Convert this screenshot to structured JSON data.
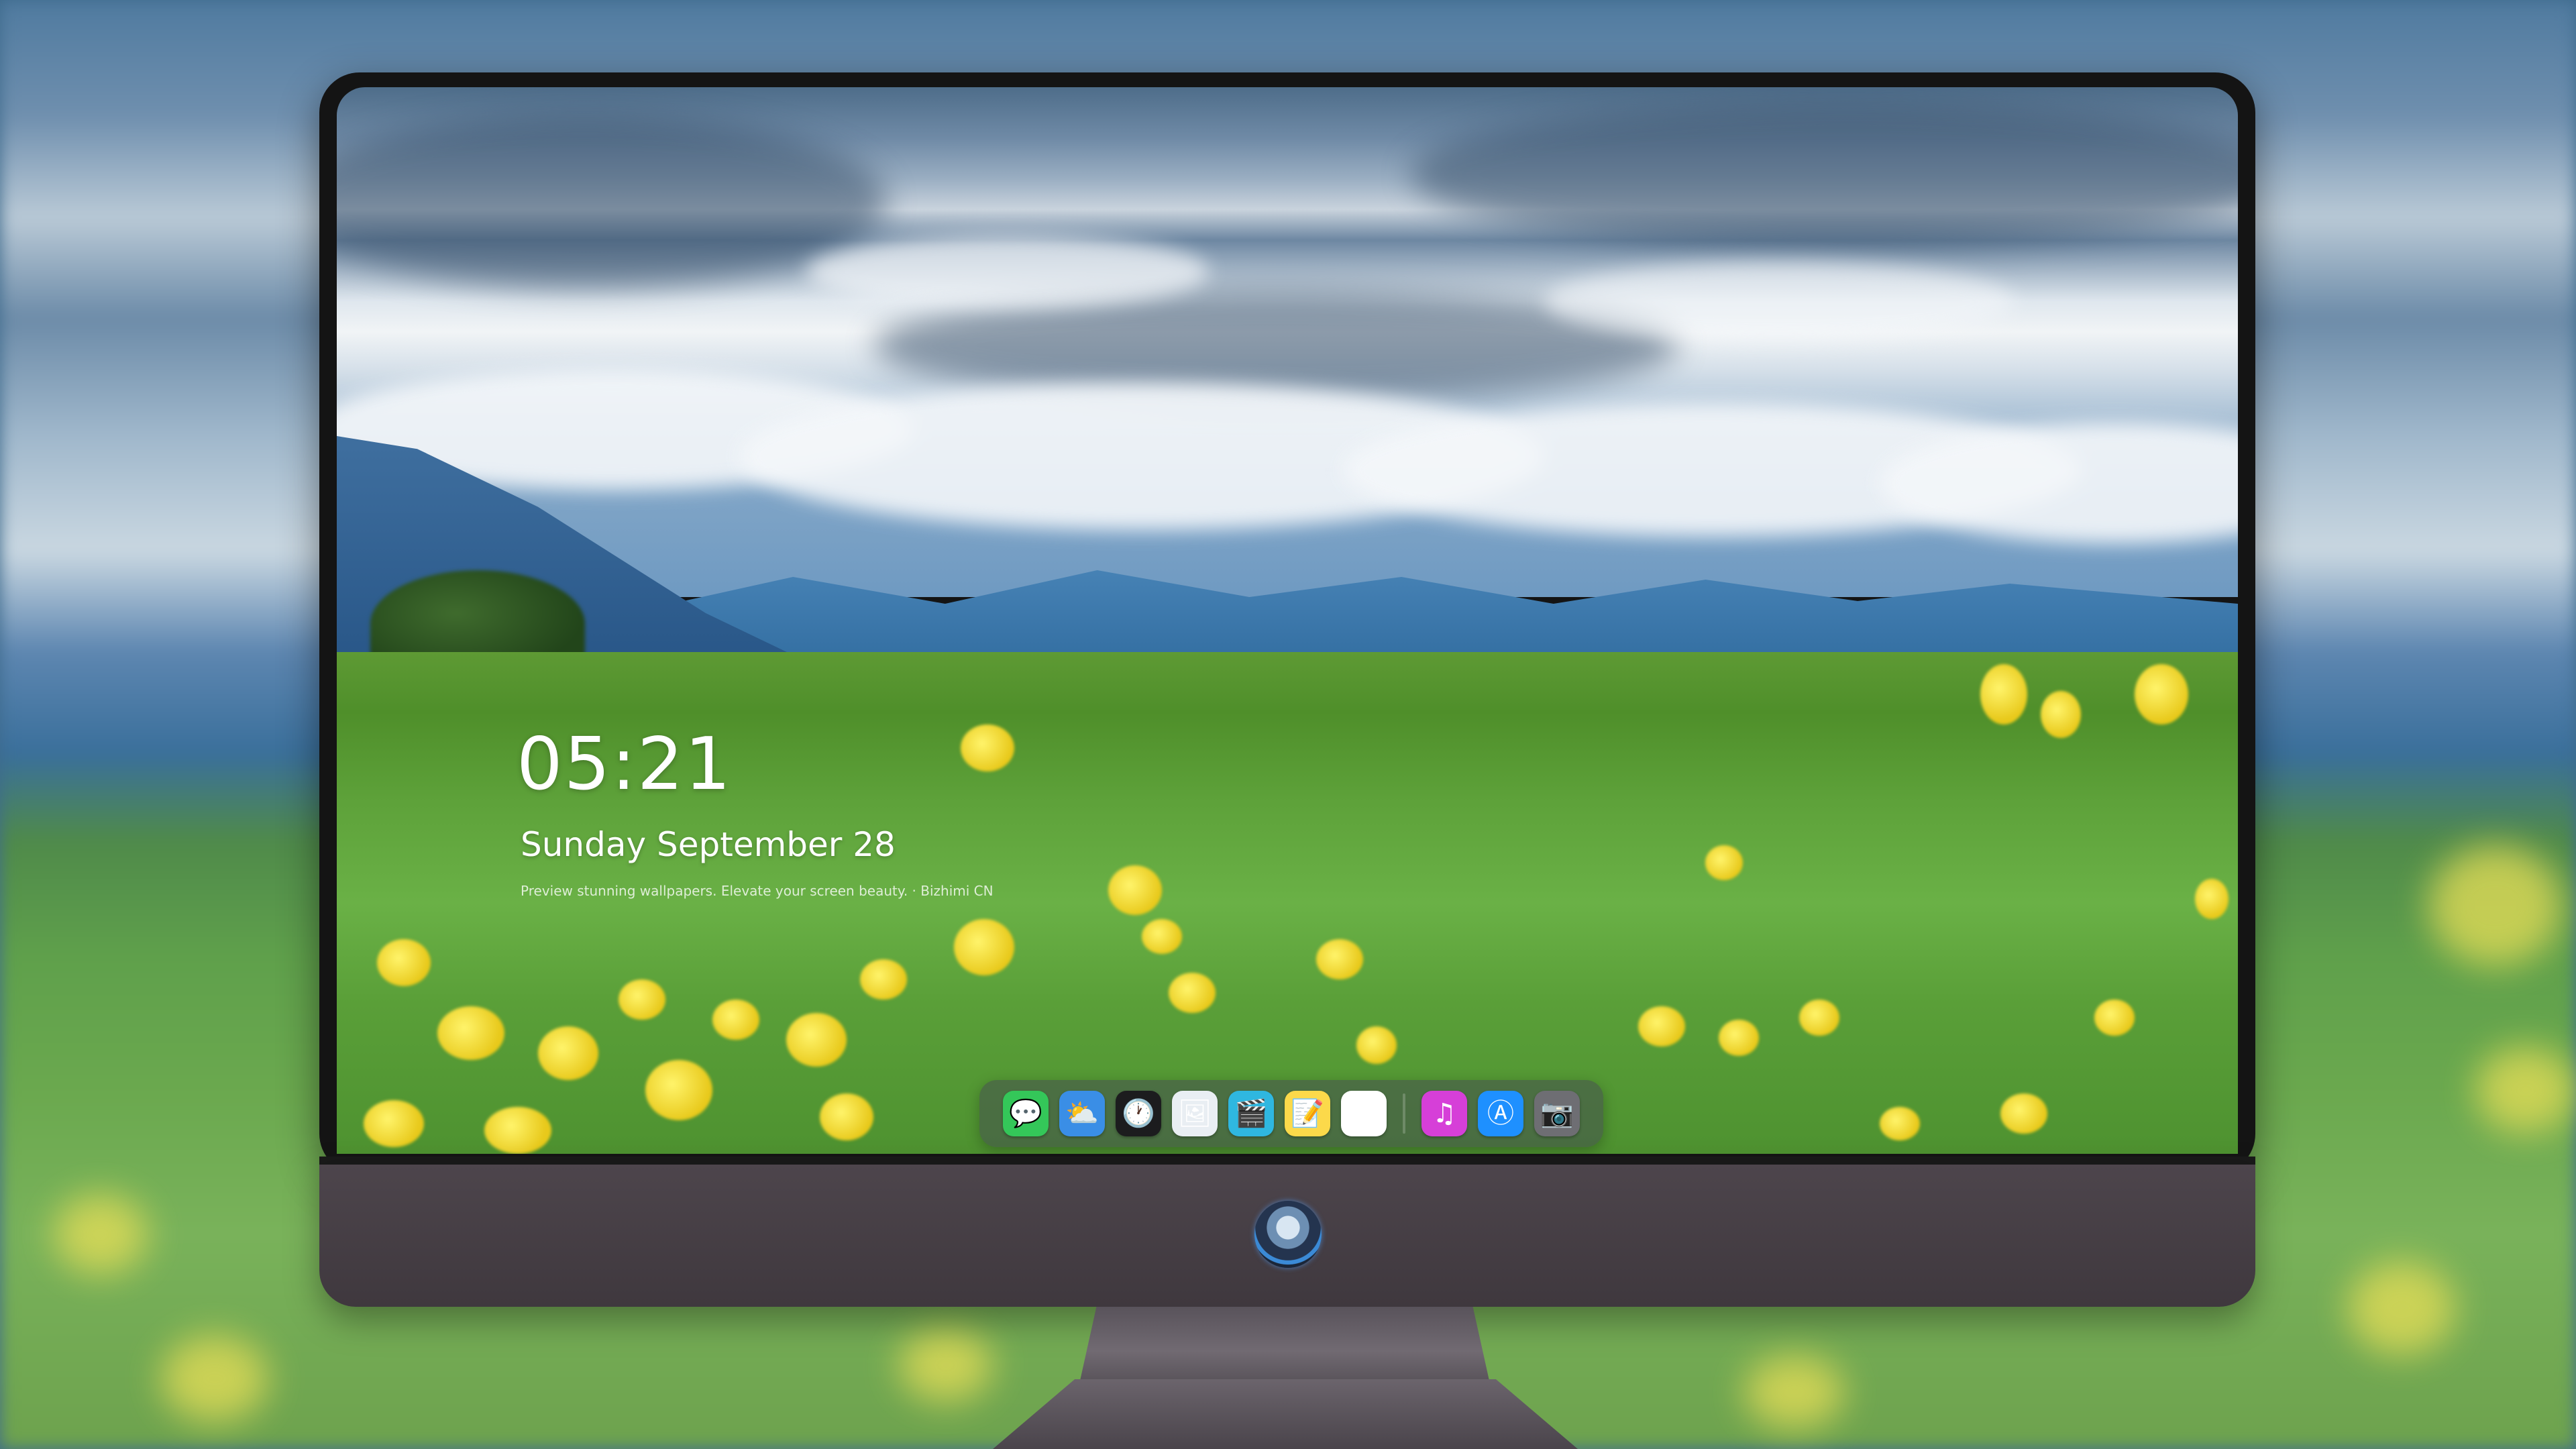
{
  "lockscreen": {
    "time": "05:21",
    "date": "Sunday September  28",
    "tagline": "Preview stunning wallpapers. Elevate your screen beauty. · Bizhimi CN"
  },
  "dock": {
    "apps": [
      {
        "name": "messages-icon",
        "glyph": "💬",
        "color": "#34c759"
      },
      {
        "name": "weather-icon",
        "glyph": "⛅",
        "color": "#3a8ee6"
      },
      {
        "name": "clock-icon",
        "glyph": "🕐",
        "color": "#1c1c1e"
      },
      {
        "name": "preview-icon",
        "glyph": "🖼",
        "color": "#e9eef3"
      },
      {
        "name": "clips-icon",
        "glyph": "🎬",
        "color": "#2fb7e0"
      },
      {
        "name": "notes-icon",
        "glyph": "📝",
        "color": "#fcd94a"
      },
      {
        "name": "photo-booth-icon",
        "glyph": "🗂",
        "color": "#ffffff"
      },
      {
        "name": "music-icon",
        "glyph": "♫",
        "color": "#d63fd8"
      },
      {
        "name": "app-store-icon",
        "glyph": "Ⓐ",
        "color": "#1e90ff"
      },
      {
        "name": "camera-icon",
        "glyph": "📷",
        "color": "#6e6e73"
      }
    ]
  },
  "colors": {
    "bezel": "#141414",
    "chin": "#4d454c",
    "dock_bg": "rgba(70,78,80,0.55)"
  }
}
